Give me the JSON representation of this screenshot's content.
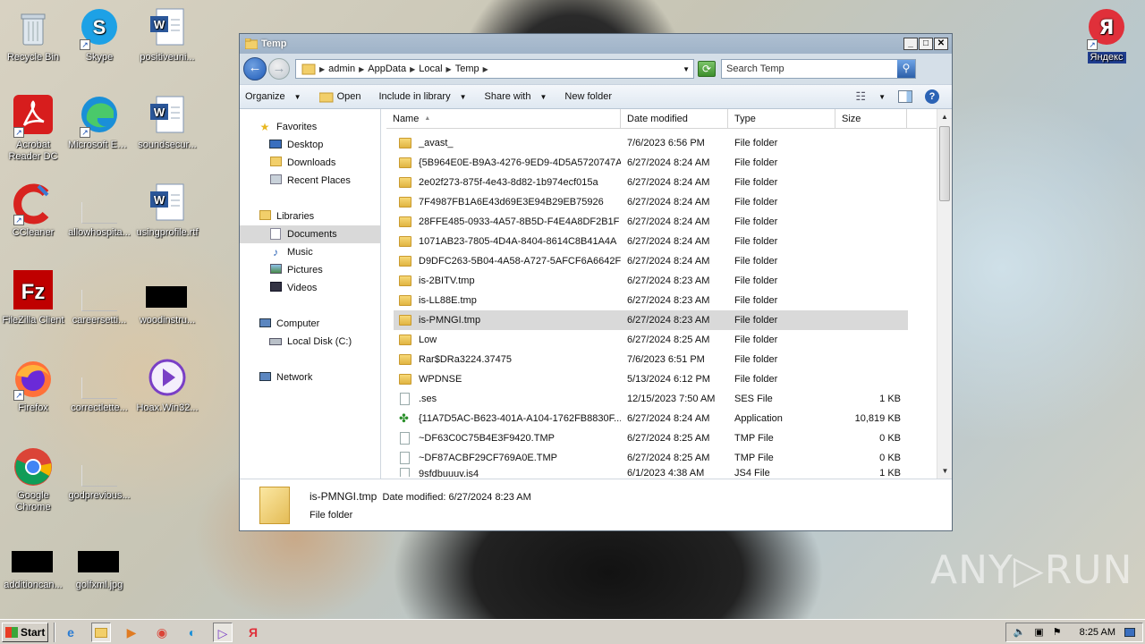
{
  "desktop": {
    "icons": [
      {
        "label": "Recycle Bin",
        "glyph": "🗑"
      },
      {
        "label": "Skype",
        "glyph": "S"
      },
      {
        "label": "positiveuni...",
        "glyph": "W"
      },
      {
        "label": "Acrobat Reader DC",
        "glyph": "A"
      },
      {
        "label": "Microsoft Edge",
        "glyph": "e"
      },
      {
        "label": "soundsecur...",
        "glyph": "W"
      },
      {
        "label": "CCleaner",
        "glyph": "C"
      },
      {
        "label": "allowhospita...",
        "glyph": ""
      },
      {
        "label": "usingprofile.rtf",
        "glyph": "W"
      },
      {
        "label": "FileZilla Client",
        "glyph": "Fz"
      },
      {
        "label": "careersetti...",
        "glyph": ""
      },
      {
        "label": "woodinstru...",
        "glyph": ""
      },
      {
        "label": "Firefox",
        "glyph": "🦊"
      },
      {
        "label": "correctlette...",
        "glyph": ""
      },
      {
        "label": "Hoax.Win32...",
        "glyph": "▶"
      },
      {
        "label": "Google Chrome",
        "glyph": "◉"
      },
      {
        "label": "godprevious...",
        "glyph": ""
      },
      {
        "label": "additioncan...",
        "glyph": ""
      },
      {
        "label": "golfxml.jpg",
        "glyph": ""
      },
      {
        "label": "Яндекс",
        "glyph": "Я"
      }
    ],
    "watermark": "ANY▷RUN"
  },
  "window": {
    "title": "Temp",
    "buttons": {
      "minimize": "_",
      "maximize": "□",
      "close": "✕"
    },
    "breadcrumb": [
      "admin",
      "AppData",
      "Local",
      "Temp"
    ],
    "search_placeholder": "Search Temp",
    "commands": {
      "organize": "Organize",
      "open": "Open",
      "include": "Include in library",
      "share": "Share with",
      "new_folder": "New folder"
    },
    "nav": {
      "favorites": "Favorites",
      "desktop": "Desktop",
      "downloads": "Downloads",
      "recent": "Recent Places",
      "libraries": "Libraries",
      "documents": "Documents",
      "music": "Music",
      "pictures": "Pictures",
      "videos": "Videos",
      "computer": "Computer",
      "localdisk": "Local Disk (C:)",
      "network": "Network"
    },
    "columns": {
      "name": "Name",
      "date": "Date modified",
      "type": "Type",
      "size": "Size"
    },
    "files": [
      {
        "name": "_avast_",
        "date": "7/6/2023 6:56 PM",
        "type": "File folder",
        "size": "",
        "kind": "folder"
      },
      {
        "name": "{5B964E0E-B9A3-4276-9ED9-4D5A5720747A}",
        "date": "6/27/2024 8:24 AM",
        "type": "File folder",
        "size": "",
        "kind": "folder"
      },
      {
        "name": "2e02f273-875f-4e43-8d82-1b974ecf015a",
        "date": "6/27/2024 8:24 AM",
        "type": "File folder",
        "size": "",
        "kind": "folder"
      },
      {
        "name": "7F4987FB1A6E43d69E3E94B29EB75926",
        "date": "6/27/2024 8:24 AM",
        "type": "File folder",
        "size": "",
        "kind": "folder"
      },
      {
        "name": "28FFE485-0933-4A57-8B5D-F4E4A8DF2B1F",
        "date": "6/27/2024 8:24 AM",
        "type": "File folder",
        "size": "",
        "kind": "folder"
      },
      {
        "name": "1071AB23-7805-4D4A-8404-8614C8B41A4A",
        "date": "6/27/2024 8:24 AM",
        "type": "File folder",
        "size": "",
        "kind": "folder"
      },
      {
        "name": "D9DFC263-5B04-4A58-A727-5AFCF6A6642F",
        "date": "6/27/2024 8:24 AM",
        "type": "File folder",
        "size": "",
        "kind": "folder"
      },
      {
        "name": "is-2BITV.tmp",
        "date": "6/27/2024 8:23 AM",
        "type": "File folder",
        "size": "",
        "kind": "folder"
      },
      {
        "name": "is-LL88E.tmp",
        "date": "6/27/2024 8:23 AM",
        "type": "File folder",
        "size": "",
        "kind": "folder"
      },
      {
        "name": "is-PMNGI.tmp",
        "date": "6/27/2024 8:23 AM",
        "type": "File folder",
        "size": "",
        "kind": "folder",
        "selected": true
      },
      {
        "name": "Low",
        "date": "6/27/2024 8:25 AM",
        "type": "File folder",
        "size": "",
        "kind": "folder"
      },
      {
        "name": "Rar$DRa3224.37475",
        "date": "7/6/2023 6:51 PM",
        "type": "File folder",
        "size": "",
        "kind": "folder"
      },
      {
        "name": "WPDNSE",
        "date": "5/13/2024 6:12 PM",
        "type": "File folder",
        "size": "",
        "kind": "folder"
      },
      {
        "name": ".ses",
        "date": "12/15/2023 7:50 AM",
        "type": "SES File",
        "size": "1 KB",
        "kind": "file"
      },
      {
        "name": "{11A7D5AC-B623-401A-A104-1762FB8830F...",
        "date": "6/27/2024 8:24 AM",
        "type": "Application",
        "size": "10,819 KB",
        "kind": "app"
      },
      {
        "name": "~DF63C0C75B4E3F9420.TMP",
        "date": "6/27/2024 8:25 AM",
        "type": "TMP File",
        "size": "0 KB",
        "kind": "file"
      },
      {
        "name": "~DF87ACBF29CF769A0E.TMP",
        "date": "6/27/2024 8:25 AM",
        "type": "TMP File",
        "size": "0 KB",
        "kind": "file"
      },
      {
        "name": "9sfdbuuuy.js4",
        "date": "6/1/2023 4:38 AM",
        "type": "JS4 File",
        "size": "1 KB",
        "kind": "file"
      }
    ],
    "details": {
      "name": "is-PMNGI.tmp",
      "modified": "Date modified: 6/27/2024 8:23 AM",
      "type": "File folder"
    }
  },
  "taskbar": {
    "start": "Start",
    "time": "8:25 AM"
  }
}
